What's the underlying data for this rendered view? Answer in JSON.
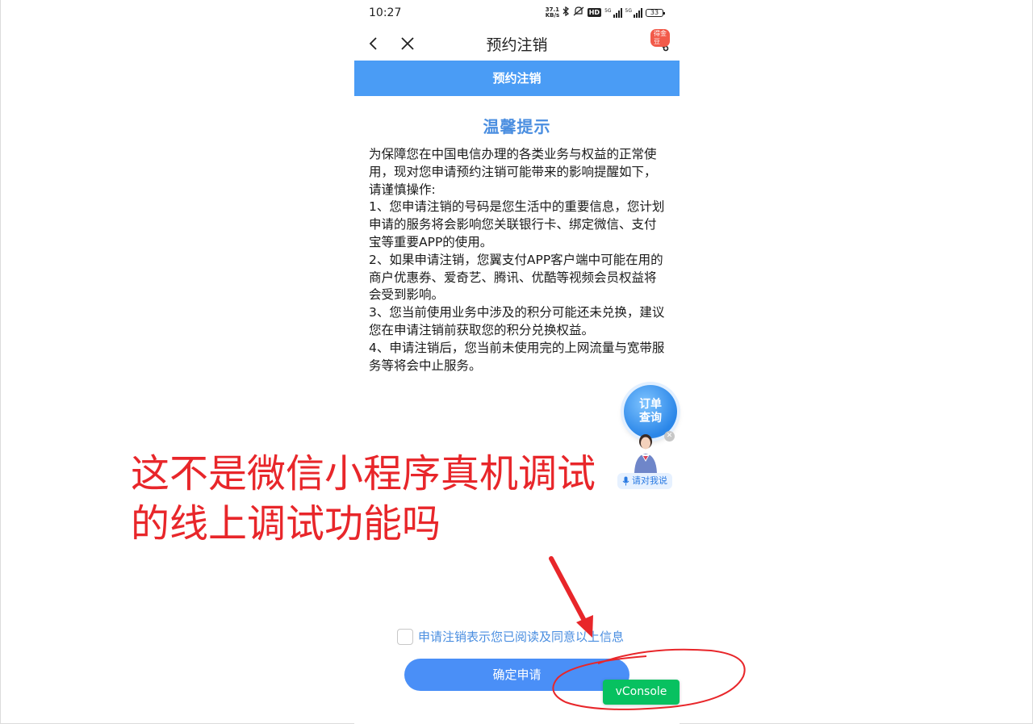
{
  "status_bar": {
    "time": "10:27",
    "net_speed_value": "37.1",
    "net_speed_unit": "KB/s",
    "hd_label": "HD",
    "signal1_label": "5G",
    "signal2_label": "5G",
    "battery": "33"
  },
  "nav": {
    "title": "预约注销",
    "gold_badge": "得金豆"
  },
  "header": {
    "label": "预约注销"
  },
  "notice": {
    "title": "温馨提示",
    "body": "为保障您在中国电信办理的各类业务与权益的正常使用，现对您申请预约注销可能带来的影响提醒如下，请谨慎操作:\n1、您申请注销的号码是您生活中的重要信息，您计划申请的服务将会影响您关联银行卡、绑定微信、支付宝等重要APP的使用。\n2、如果申请注销，您翼支付APP客户端中可能在用的商户优惠券、爱奇艺、腾讯、优酷等视频会员权益将会受到影响。\n3、您当前使用业务中涉及的积分可能还未兑换，建议您在申请注销前获取您的积分兑换权益。\n4、申请注销后，您当前未使用完的上网流量与宽带服务等将会中止服务。"
  },
  "assistant": {
    "order_query": "订单\n查询",
    "speak_label": "请对我说"
  },
  "agreement": {
    "text": "申请注销表示您已阅读及同意以上信息",
    "checked": false
  },
  "actions": {
    "confirm_label": "确定申请",
    "vconsole_label": "vConsole"
  },
  "annotation": {
    "text": "这不是微信小程序真机调试\n的线上调试功能吗",
    "color": "#e8262a"
  },
  "colors": {
    "header_blue": "#4a9cf5",
    "button_blue": "#4a8ff7",
    "title_blue": "#4a8ee0",
    "vconsole_green": "#07c160",
    "badge_red": "#f25a4a"
  }
}
